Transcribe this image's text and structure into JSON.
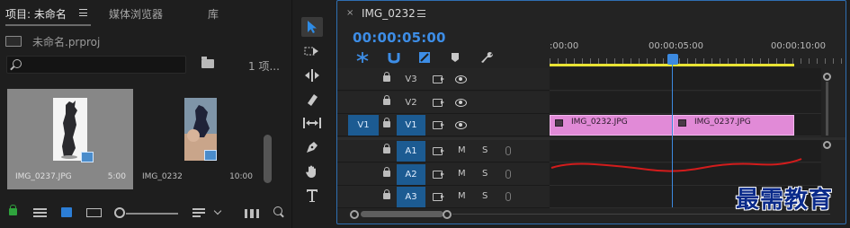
{
  "project_panel": {
    "tabs": [
      {
        "label": "项目: 未命名"
      },
      {
        "label": "媒体浏览器"
      },
      {
        "label": "库"
      }
    ],
    "project_file": "未命名.prproj",
    "search_placeholder": "",
    "item_count": "1 项...",
    "items": [
      {
        "name": "IMG_0237.JPG",
        "duration": "5:00",
        "selected": true
      },
      {
        "name": "IMG_0232",
        "duration": "10:00",
        "selected": false
      }
    ]
  },
  "tools": {
    "items": [
      "selection-tool",
      "track-select-tool",
      "ripple-edit-tool",
      "razor-tool",
      "slip-tool",
      "pen-tool",
      "hand-tool",
      "type-tool"
    ],
    "active": "selection-tool"
  },
  "timeline": {
    "close": "×",
    "sequence_name": "IMG_0232",
    "timecode": "00:00:05:00",
    "ruler_labels": [
      ":00:00",
      "00:00:05:00",
      "00:00:10:00"
    ],
    "playhead_time": "00:00:05:00",
    "video_tracks": [
      {
        "label": "V3",
        "source": ""
      },
      {
        "label": "V2",
        "source": ""
      },
      {
        "label": "V1",
        "source": "V1"
      }
    ],
    "audio_tracks": [
      {
        "label": "A1",
        "m": "M",
        "s": "S"
      },
      {
        "label": "A2",
        "m": "M",
        "s": "S"
      },
      {
        "label": "A3",
        "m": "M",
        "s": "S"
      }
    ],
    "clips": [
      {
        "track": "V1",
        "name": "IMG_0232.JPG"
      },
      {
        "track": "V1",
        "name": "IMG_0237.JPG"
      }
    ],
    "colors": {
      "accent": "#3d8de6",
      "clip": "#e18ad7",
      "work_area": "#e9e334",
      "annotation": "#d21c1c"
    }
  },
  "watermark": "最需教育"
}
